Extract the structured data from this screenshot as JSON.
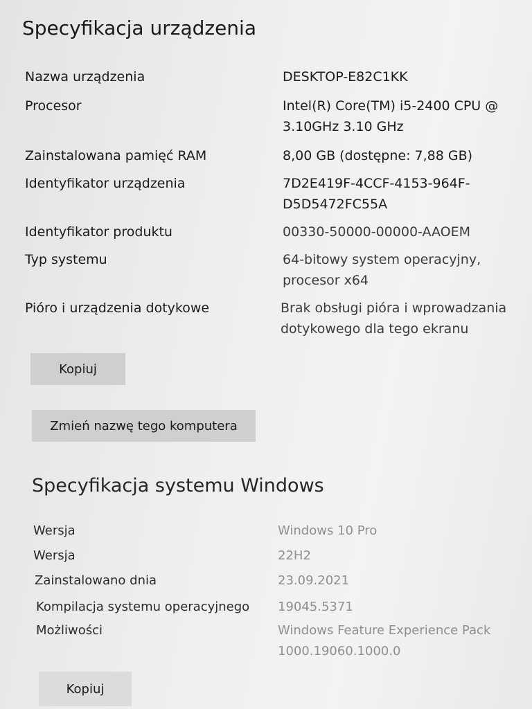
{
  "device_spec": {
    "title": "Specyfikacja urządzenia",
    "rows": [
      {
        "label": "Nazwa urządzenia",
        "value": "DESKTOP-E82C1KK"
      },
      {
        "label": "Procesor",
        "value": "Intel(R) Core(TM) i5-2400 CPU @ 3.10GHz   3.10 GHz"
      },
      {
        "label": "Zainstalowana pamięć RAM",
        "value": "8,00 GB (dostępne: 7,88 GB)"
      },
      {
        "label": "Identyfikator urządzenia",
        "value": "7D2E419F-4CCF-4153-964F-D5D5472FC55A"
      },
      {
        "label": "Identyfikator produktu",
        "value": "00330-50000-00000-AAOEM"
      },
      {
        "label": "Typ systemu",
        "value": "64-bitowy system operacyjny, procesor x64"
      },
      {
        "label": "Pióro i urządzenia dotykowe",
        "value": "Brak obsługi pióra i wprowadzania dotykowego dla tego ekranu"
      }
    ],
    "copy_button": "Kopiuj",
    "rename_button": "Zmień nazwę tego komputera"
  },
  "windows_spec": {
    "title": "Specyfikacja systemu Windows",
    "rows": [
      {
        "label": "Wersja",
        "value": "Windows 10 Pro"
      },
      {
        "label": "Wersja",
        "value": "22H2"
      },
      {
        "label": "Zainstalowano dnia",
        "value": "23.09.2021"
      },
      {
        "label": "Kompilacja systemu operacyjnego",
        "value": "19045.5371"
      },
      {
        "label": "Możliwości",
        "value": "Windows Feature Experience Pack 1000.19060.1000.0"
      }
    ],
    "copy_button": "Kopiuj"
  }
}
